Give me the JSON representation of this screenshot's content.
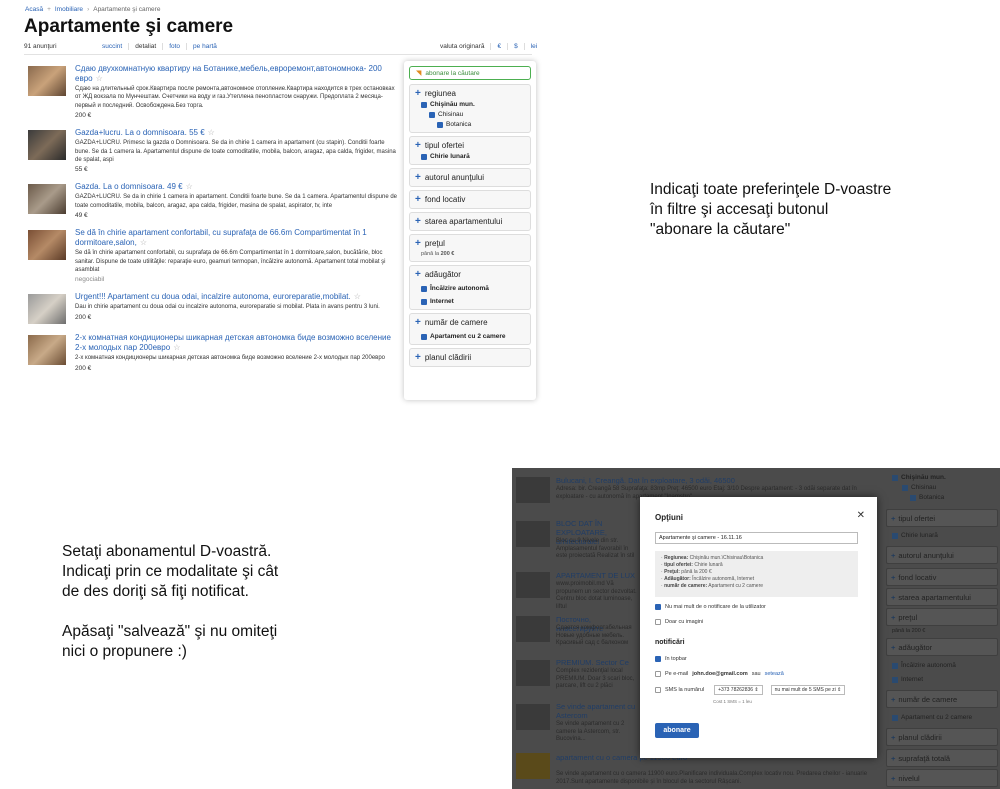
{
  "breadcrumb": [
    "Acasă",
    "Imobiliare",
    "Apartamente şi camere"
  ],
  "page_title": "Apartamente şi camere",
  "result_count": "91 anunţuri",
  "view_tabs": [
    "succint",
    "detaliat",
    "foto",
    "pe hartă"
  ],
  "currency": [
    "valuta originară",
    "€",
    "$",
    "lei"
  ],
  "listings": [
    {
      "title": "Сдаю двухкомнатную квартиру на Ботанике,мебель,евроремонт,автономнока- 200 евро",
      "desc": "Сдаю на длительный срок.Квартира после ремонта,автономное отопление.Квартира находится в трех остановках от ЖД вокзала по Мунчештам. Счетчики на воду и газ.Утеплена пенопластом снаружи. Предоплата 2 месяца-первый и последний. Освобождена.Без торга.",
      "price": "200 €"
    },
    {
      "title": "Gazda+lucru. La o domnisoara. 55 €",
      "desc": "GAZDA+LUCRU. Primesc la gazda o Domnisoara. Se da in chirie 1 camera in apartament (cu stapin). Conditii foarte bune. Se da 1 camera la. Apartamentul dispune de toate comoditatile, mobila, balcon, aragaz, apa calda, frigider, masina de spalat, aspi",
      "price": "55 €"
    },
    {
      "title": "Gazda. La o domnisoara. 49 €",
      "desc": "GAZDA+LUCRU. Se da in chirie 1 camera in apartament. Conditii foarte bune. Se da 1 camera. Apartamentul dispune de toate comoditatile, mobila, balcon, aragaz, apa calda, frigider, masina de spalat, aspirator, tv, inte",
      "price": "49 €"
    },
    {
      "title": "Se dă în chirie apartament confortabil, cu suprafaţa de 66.6m Compartimentat în 1 dormitoare,salon,",
      "desc": "Se dă în chirie apartament confortabil, cu suprafaţa de 66.6m Compartimentat în 1 dormitoare,salon, bucătărie, bloc sanitar. Dispune de toate utilităţile: reparaţie euro, geamuri termopan, încălzire autonomă. Apartament total mobilat şi asamblat",
      "price": "negociabil"
    },
    {
      "title": "Urgent!!! Apartament cu doua odai, incalzire autonoma, euroreparatie,mobilat.",
      "desc": "Dau in chirie apartament cu doua odai cu incalzire autonoma, euroreparatie si mobilat. Plata in avans pentru 3 luni.",
      "price": "200 €"
    },
    {
      "title": "2-х комнатная кондиционеры шикарная детская автономка биде возможно вселение 2-х молодых пар 200евро",
      "desc": "2-х комнатная кондиционеры шикарная детская автономка биде возможно вселение 2-х молодых пар 200евро",
      "price": "200 €"
    }
  ],
  "filters": {
    "subscribe": "abonare la căutare",
    "region": "regiunea",
    "region_opts": [
      "Chişinău mun.",
      "Chisinau",
      "Botanica"
    ],
    "offer_type": "tipul ofertei",
    "offer_opt": "Chirie lunară",
    "author": "autorul anunţului",
    "fund": "fond locativ",
    "state": "starea apartamentului",
    "price": "preţul",
    "price_sub": "până la",
    "price_val": "200 €",
    "extra": "adăugător",
    "extra_opts": [
      "Încălzire autonomă",
      "Internet"
    ],
    "rooms": "număr de camere",
    "rooms_opt": "Apartament cu 2 camere",
    "plan": "planul clădirii"
  },
  "instruction1": "Indicaţi toate preferinţele D-voastre\nîn filtre şi accesaţi butonul\n\"abonare la căutare\"",
  "instruction2": "Setaţi abonamentul D-voastră.\nIndicaţi prin ce modalitate şi cât\nde des doriţi să fiţi notificat.\n\nApăsaţi \"salvează\" şi nu omiteţi\nnici o propunere :)",
  "bg_listings": [
    {
      "title": "Bulucani, I. Creangă. Dat în exploatare, 3 odăi, 46500",
      "desc": "Adresa: bir. Creangă 58 Suprafaţa: 83mp Preţ: 46500 euro Etaj: 3/10 Despre apartament: - 3 odăi separate dat în exploatare - cu autonomă în apartament \"Inamstro\""
    },
    {
      "title": "BLOC DAT ÎN EXPLOATARE, arhitecturale!",
      "desc": "Bloc cu 9 Nivele din str. Amplasamentul favorabil în este proiectată Realizat în stil"
    },
    {
      "title": "APARTAMENT DE LUX",
      "desc": "www.proimobil.md Vă propunem un sector dezvoltat. Centru bloc dotat luminoase, liftul"
    },
    {
      "title": "Посточно, инвестируйте",
      "desc": "Сдается комфортабельная Новые удобные мебель. Красивый сад с балконом"
    },
    {
      "title": "PREMIUM. Sector Ce",
      "desc": "Complex rezidenţial local PREMIUM. Doar 3 scari bloc, parcare, lift cu 2 plăci"
    },
    {
      "title": "Se vinde apartament cu Astercom",
      "desc": "Se vinde apartament cu 2 camere la Astercom, str. Bucovina..."
    },
    {
      "title": "apartament cu o camera pe 11900 euro",
      "desc": "Se vinde apartament cu o camera 11900 euro.Planificare individuala.Complex locativ nou. Predarea cheilor - ianuarie 2017.Sunt apartamente disponibile și în blocul de la sectorul Râșcani."
    }
  ],
  "bg_filters": [
    "tipul ofertei",
    "autorul anunţului",
    "fond locativ",
    "starea apartamentului",
    "preţul",
    "adăugător",
    "număr de camere",
    "planul clădirii",
    "suprafaţă totală",
    "nivelul"
  ],
  "bg_filter_opts": {
    "region1": "Chişinău mun.",
    "region2": "Chisinau",
    "region3": "Botanica",
    "offer": "Chirie lunară",
    "price": "până la 200 €",
    "extra1": "Încălzire autonomă",
    "extra2": "Internet",
    "rooms": "Apartament cu 2 camere"
  },
  "dialog": {
    "title": "Opţiuni",
    "name_value": "Apartamente şi camere - 16.11.16",
    "summary": [
      {
        "k": "Regiunea:",
        "v": "Chişinău mun.\\Chisinau\\Botanica"
      },
      {
        "k": "tipul ofertei:",
        "v": "Chirie lunară"
      },
      {
        "k": "Preţul:",
        "v": "până la 200 €"
      },
      {
        "k": "Adăugător:",
        "v": "Încălzire autonomă, Internet"
      },
      {
        "k": "număr de camere:",
        "v": "Apartament cu 2 camere"
      }
    ],
    "opt1": "Nu mai mult de o notificare de la utilizator",
    "opt2": "Doar cu imagini",
    "notif_title": "notificări",
    "n1": "în topbar",
    "n2_pre": "Pe e-mail",
    "n2_email": "john.doe@gmail.com",
    "n2_mid": "sau",
    "n2_link": "setează",
    "n3": "SMS la numărul",
    "phone": "+373 78262836",
    "freq": "nu mai mult de 5 SMS pe zi",
    "cost": "Cost 1 SMS = 1 leu",
    "submit": "abonare"
  },
  "colors": {
    "link": "#2a63b5",
    "accent_green": "#4caf50",
    "overlay": "#4b4b4b"
  }
}
